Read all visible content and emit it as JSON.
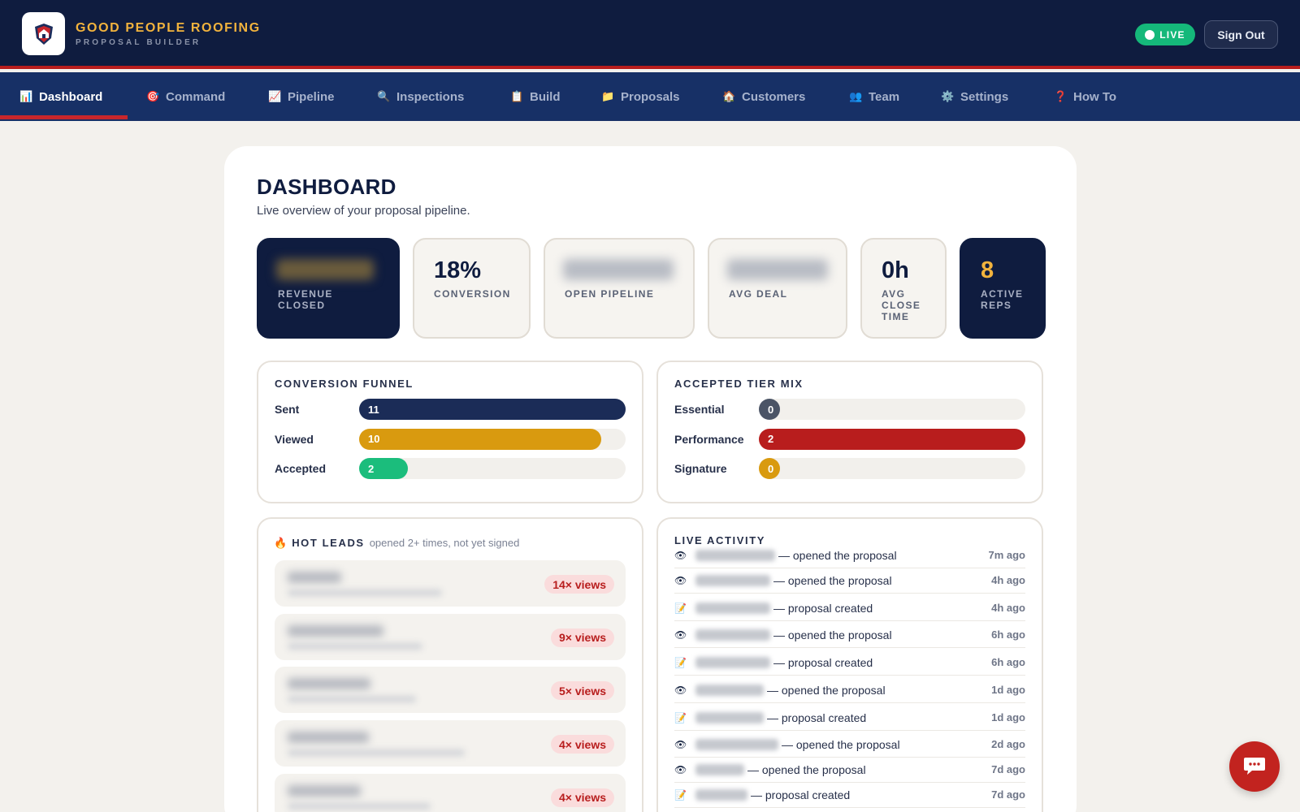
{
  "brand": {
    "title": "GOOD PEOPLE ROOFING",
    "subtitle": "PROPOSAL BUILDER"
  },
  "header": {
    "live_label": "LIVE",
    "signout_label": "Sign Out"
  },
  "nav": [
    {
      "label": "Dashboard",
      "icon": "📊",
      "icon_name": "chart-icon"
    },
    {
      "label": "Command",
      "icon": "🎯",
      "icon_name": "target-icon"
    },
    {
      "label": "Pipeline",
      "icon": "📈",
      "icon_name": "trend-icon"
    },
    {
      "label": "Inspections",
      "icon": "🔍",
      "icon_name": "magnifier-icon"
    },
    {
      "label": "Build",
      "icon": "📋",
      "icon_name": "clipboard-icon"
    },
    {
      "label": "Proposals",
      "icon": "📁",
      "icon_name": "folder-icon"
    },
    {
      "label": "Customers",
      "icon": "🏠",
      "icon_name": "house-icon"
    },
    {
      "label": "Team",
      "icon": "👥",
      "icon_name": "people-icon"
    },
    {
      "label": "Settings",
      "icon": "⚙️",
      "icon_name": "gear-icon"
    },
    {
      "label": "How To",
      "icon": "❓",
      "icon_name": "question-icon"
    }
  ],
  "page": {
    "title": "DASHBOARD",
    "subtitle": "Live overview of your proposal pipeline."
  },
  "kpis": [
    {
      "label": "REVENUE CLOSED",
      "value": null
    },
    {
      "label": "CONVERSION",
      "value": "18%"
    },
    {
      "label": "OPEN PIPELINE",
      "value": null
    },
    {
      "label": "AVG DEAL",
      "value": null
    },
    {
      "label": "AVG CLOSE TIME",
      "value": "0h"
    },
    {
      "label": "ACTIVE REPS",
      "value": "8"
    }
  ],
  "funnel": {
    "title": "CONVERSION FUNNEL",
    "rows": [
      {
        "label": "Sent",
        "value": "11",
        "fraction": 1.0,
        "color": "#1b2c57"
      },
      {
        "label": "Viewed",
        "value": "10",
        "fraction": 0.909,
        "color": "#d99a0f"
      },
      {
        "label": "Accepted",
        "value": "2",
        "fraction": 0.182,
        "color": "#1bbd7c"
      }
    ]
  },
  "tiers": {
    "title": "ACCEPTED TIER MIX",
    "rows": [
      {
        "label": "Essential",
        "value": "0",
        "fraction": 0,
        "color": "#4b5466"
      },
      {
        "label": "Performance",
        "value": "2",
        "fraction": 1.0,
        "color": "#b81d1d"
      },
      {
        "label": "Signature",
        "value": "0",
        "fraction": 0,
        "color": "#d99a0f"
      }
    ]
  },
  "hot_leads": {
    "icon": "🔥",
    "title": "HOT LEADS",
    "note": "opened 2+ times, not yet signed",
    "items": [
      {
        "views": "14× views"
      },
      {
        "views": "9× views"
      },
      {
        "views": "5× views"
      },
      {
        "views": "4× views"
      },
      {
        "views": "4× views"
      }
    ]
  },
  "activity": {
    "title": "LIVE ACTIVITY",
    "items": [
      {
        "icon": "👁",
        "text": "— opened the proposal",
        "time": "7m ago"
      },
      {
        "icon": "👁",
        "text": "— opened the proposal",
        "time": "4h ago"
      },
      {
        "icon": "📝",
        "text": "— proposal created",
        "time": "4h ago"
      },
      {
        "icon": "👁",
        "text": "— opened the proposal",
        "time": "6h ago"
      },
      {
        "icon": "📝",
        "text": "— proposal created",
        "time": "6h ago"
      },
      {
        "icon": "👁",
        "text": "— opened the proposal",
        "time": "1d ago"
      },
      {
        "icon": "📝",
        "text": "— proposal created",
        "time": "1d ago"
      },
      {
        "icon": "👁",
        "text": "— opened the proposal",
        "time": "2d ago"
      },
      {
        "icon": "👁",
        "text": "— opened the proposal",
        "time": "7d ago"
      },
      {
        "icon": "📝",
        "text": "— proposal created",
        "time": "7d ago"
      }
    ]
  },
  "colors": {
    "navy": "#0f1c3f",
    "nav": "#173066",
    "gold": "#f2b33d",
    "red": "#b81d1d",
    "green": "#15b87a"
  }
}
